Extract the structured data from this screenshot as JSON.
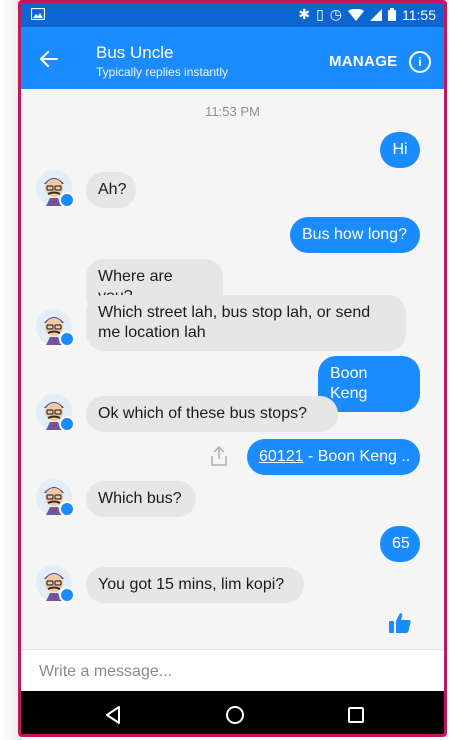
{
  "statusbar": {
    "time": "11:55",
    "icons": [
      "image-icon",
      "bluetooth-icon",
      "vibrate-icon",
      "alarm-icon",
      "wifi-icon",
      "signal-icon",
      "battery-icon"
    ]
  },
  "header": {
    "title": "Bus Uncle",
    "subtitle": "Typically replies instantly",
    "manage_label": "MANAGE",
    "info_label": "i"
  },
  "conversation": {
    "timestamp": "11:53 PM",
    "messages": [
      {
        "from": "me",
        "text": "Hi"
      },
      {
        "from": "bot",
        "text": "Ah?"
      },
      {
        "from": "me",
        "text": "Bus how long?"
      },
      {
        "from": "bot",
        "text": "Where are you?"
      },
      {
        "from": "bot",
        "text": "Which street lah, bus stop lah, or send me location lah"
      },
      {
        "from": "me",
        "text": "Boon Keng"
      },
      {
        "from": "bot",
        "text": "Ok which of these bus stops?"
      },
      {
        "from": "me",
        "link_code": "60121",
        "link_rest": " - Boon Keng .."
      },
      {
        "from": "bot",
        "text": "Which bus?"
      },
      {
        "from": "me",
        "text": "65"
      },
      {
        "from": "bot",
        "text": "You got 15 mins, lim kopi?"
      }
    ]
  },
  "composer": {
    "placeholder": "Write a message..."
  },
  "colors": {
    "accent": "#1a8cff",
    "statusbar": "#0d66d0",
    "frame": "#c2185b",
    "incoming_bubble": "#e6e6e6"
  }
}
